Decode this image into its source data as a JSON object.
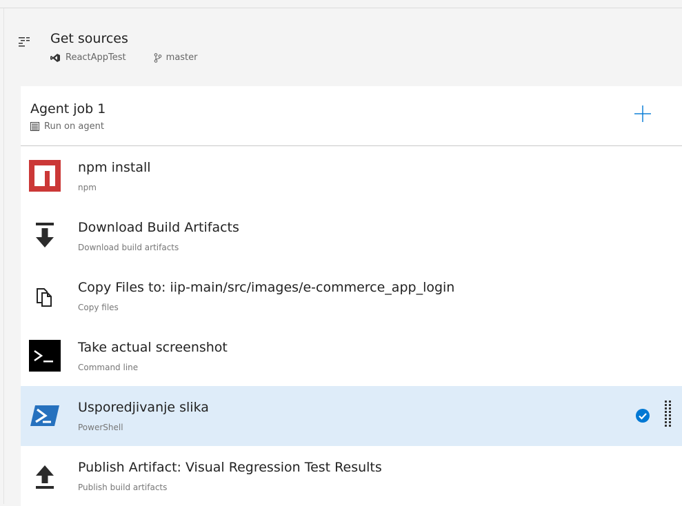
{
  "get_sources": {
    "title": "Get sources",
    "repository": "ReactAppTest",
    "branch": "master"
  },
  "agent_job": {
    "title": "Agent job 1",
    "subtitle": "Run on agent"
  },
  "tasks": [
    {
      "title": "npm install",
      "subtitle": "npm",
      "icon": "npm-icon",
      "selected": false
    },
    {
      "title": "Download Build Artifacts",
      "subtitle": "Download build artifacts",
      "icon": "download-icon",
      "selected": false
    },
    {
      "title": "Copy Files to: iip-main/src/images/e-commerce_app_login",
      "subtitle": "Copy files",
      "icon": "copy-files-icon",
      "selected": false
    },
    {
      "title": "Take actual screenshot",
      "subtitle": "Command line",
      "icon": "command-line-icon",
      "selected": false
    },
    {
      "title": "Usporedjivanje slika",
      "subtitle": "PowerShell",
      "icon": "powershell-icon",
      "selected": true,
      "enabled": true
    },
    {
      "title": "Publish Artifact: Visual Regression Test Results",
      "subtitle": "Publish build artifacts",
      "icon": "upload-icon",
      "selected": false
    }
  ],
  "colors": {
    "npm": "#cb3837",
    "accent": "#0078d4",
    "selected_bg": "#deecf9",
    "command_line": "#000000",
    "powershell": "#2671be"
  }
}
